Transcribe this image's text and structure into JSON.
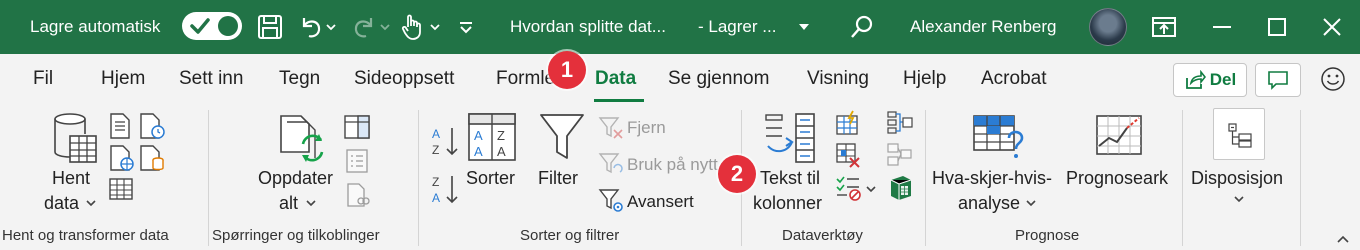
{
  "titlebar": {
    "autosave_label": "Lagre automatisk",
    "document_title": "Hvordan splitte dat...",
    "save_status": "- Lagrer ...",
    "user_name": "Alexander Renberg",
    "icons": [
      "save-icon",
      "undo-icon",
      "redo-icon",
      "touch-mode-icon",
      "customize-icon",
      "search-icon",
      "ribbon-display-icon",
      "minimize-icon",
      "maximize-icon",
      "close-icon"
    ],
    "accent": "#217346"
  },
  "tabs": {
    "items": [
      "Fil",
      "Hjem",
      "Sett inn",
      "Tegn",
      "Sideoppsett",
      "Formler",
      "Data",
      "Se gjennom",
      "Visning",
      "Hjelp",
      "Acrobat"
    ],
    "active": "Data",
    "share_label": "Del"
  },
  "ribbon": {
    "get_data": {
      "label_line1": "Hent",
      "label_line2": "data",
      "group_label": "Hent og transformer data"
    },
    "queries": {
      "refresh_line1": "Oppdater",
      "refresh_line2": "alt",
      "group_label": "Spørringer og tilkoblinger"
    },
    "sort_filter": {
      "sort_label": "Sorter",
      "filter_label": "Filter",
      "clear_label": "Fjern",
      "reapply_label": "Bruk på nytt",
      "advanced_label": "Avansert",
      "group_label": "Sorter og filtrer"
    },
    "data_tools": {
      "text_to_columns_line1": "Tekst til",
      "text_to_columns_line2": "kolonner",
      "group_label": "Dataverktøy"
    },
    "forecast": {
      "whatif_line1": "Hva-skjer-hvis-",
      "whatif_line2": "analyse",
      "forecast_sheet": "Prognoseark",
      "group_label": "Prognose"
    },
    "outline": {
      "label": "Disposisjon"
    }
  },
  "badges": {
    "badge1": "1",
    "badge2": "2",
    "color": "#e4303b"
  }
}
